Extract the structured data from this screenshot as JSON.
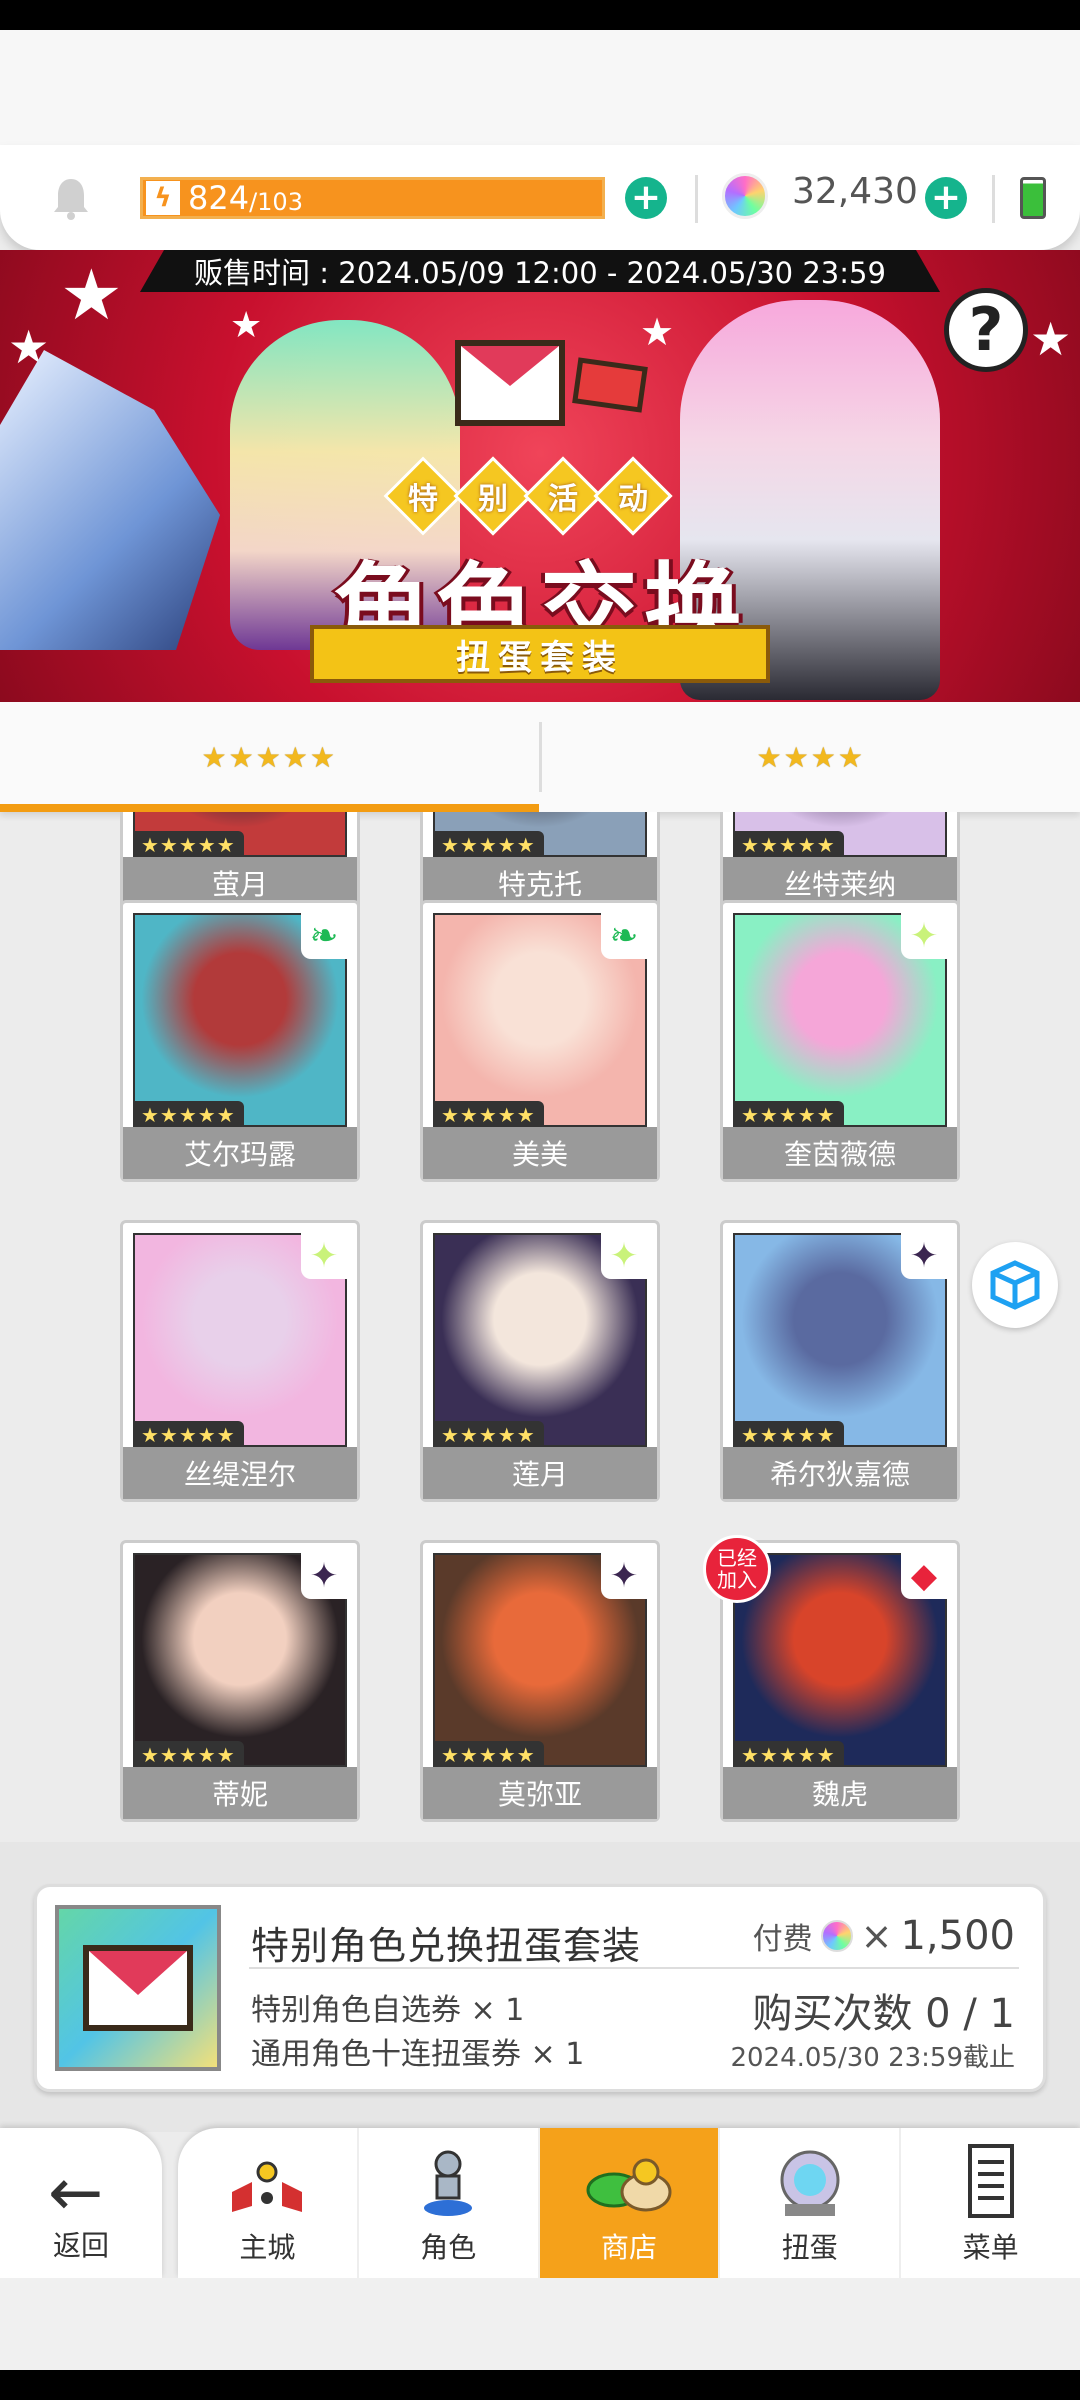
{
  "resources": {
    "energy_current": "824",
    "energy_max": "/103",
    "gems": "32,430"
  },
  "banner": {
    "sale_time": "贩售时间 : 2024.05/09 12:00 - 2024.05/30 23:59",
    "tags": [
      "特",
      "别",
      "活",
      "动"
    ],
    "title": "角色交换",
    "subtitle": "扭蛋套装",
    "help_glyph": "?"
  },
  "tabs": [
    {
      "label": "★★★★★",
      "rarity": 5
    },
    {
      "label": "★★★★",
      "rarity": 4
    }
  ],
  "characters": [
    {
      "name": "萤月",
      "stars": "★★★★★"
    },
    {
      "name": "特克托",
      "stars": "★★★★★"
    },
    {
      "name": "丝特莱纳",
      "stars": "★★★★★"
    },
    {
      "name": "艾尔玛露",
      "stars": "★★★★★",
      "element": "wind",
      "color": "#1db954"
    },
    {
      "name": "美美",
      "stars": "★★★★★",
      "element": "wind",
      "color": "#1db954"
    },
    {
      "name": "奎茵薇德",
      "stars": "★★★★★",
      "element": "light",
      "color": "#c9f27a"
    },
    {
      "name": "丝缇涅尔",
      "stars": "★★★★★",
      "element": "light",
      "color": "#c9f27a"
    },
    {
      "name": "莲月",
      "stars": "★★★★★",
      "element": "light",
      "color": "#c9f27a"
    },
    {
      "name": "希尔狄嘉德",
      "stars": "★★★★★",
      "element": "dark",
      "color": "#3b2650"
    },
    {
      "name": "蒂妮",
      "stars": "★★★★★",
      "element": "dark",
      "color": "#3b2650"
    },
    {
      "name": "莫弥亚",
      "stars": "★★★★★",
      "element": "dark",
      "color": "#3b2650"
    },
    {
      "name": "魏虎",
      "stars": "★★★★★",
      "element": "fire",
      "color": "#e8233b",
      "badge": "已经\n加入"
    }
  ],
  "product": {
    "title": "特别角色兑换扭蛋套装",
    "items": [
      "特别角色自选券 × 1",
      "通用角色十连扭蛋券 × 1"
    ],
    "price_label": "付费",
    "price_x": "×",
    "price": "1,500",
    "buy_count": "购买次数 0 / 1",
    "deadline": "2024.05/30 23:59截止"
  },
  "nav": {
    "back": "返回",
    "items": [
      "主城",
      "角色",
      "商店",
      "扭蛋",
      "菜单"
    ],
    "active": "商店"
  },
  "colors": {
    "accent": "#f5a11a",
    "banner_red": "#c8102e",
    "plus_green": "#15b48d"
  }
}
